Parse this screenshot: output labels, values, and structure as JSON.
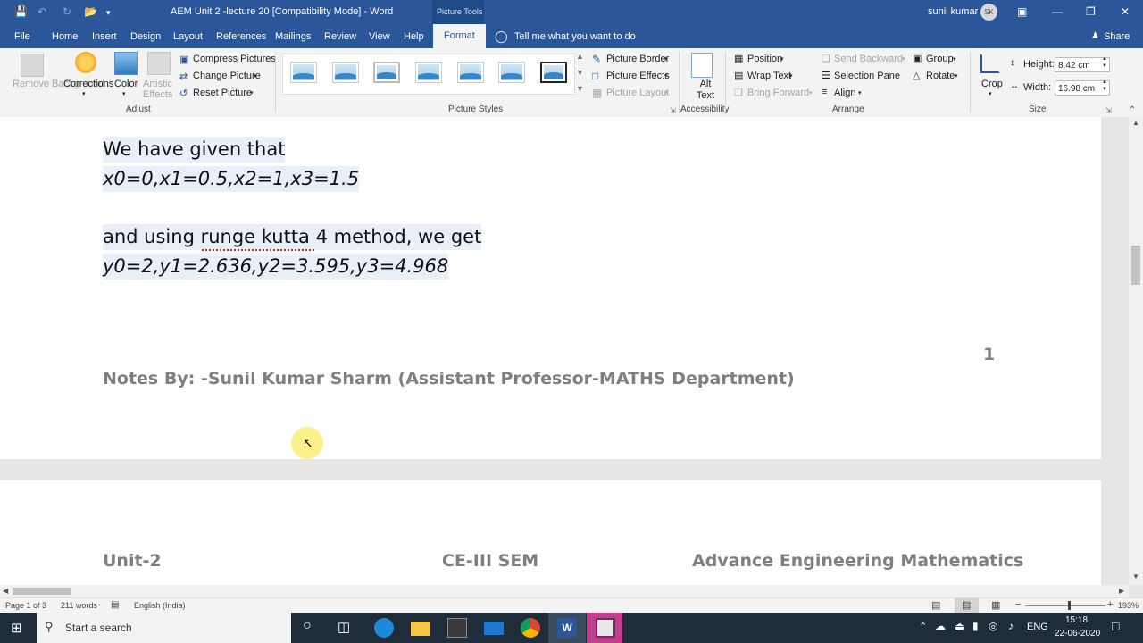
{
  "titlebar": {
    "doc_title": "AEM Unit 2 -lecture 20 [Compatibility Mode] - Word",
    "context_title": "Picture Tools",
    "user_name": "sunil kumar",
    "user_initials": "SK"
  },
  "tabs": [
    "File",
    "Home",
    "Insert",
    "Design",
    "Layout",
    "References",
    "Mailings",
    "Review",
    "View",
    "Help",
    "Format"
  ],
  "tell_me": "Tell me what you want to do",
  "share": "Share",
  "ribbon": {
    "remove_background": "Remove Background",
    "corrections": "Corrections",
    "color": "Color",
    "artistic_effects": "Artistic Effects",
    "compress_pictures": "Compress Pictures",
    "change_picture": "Change Picture",
    "reset_picture": "Reset Picture",
    "group_adjust": "Adjust",
    "group_picture_styles": "Picture Styles",
    "picture_border": "Picture Border",
    "picture_effects": "Picture Effects",
    "picture_layout": "Picture Layout",
    "alt_text": "Alt Text",
    "group_accessibility": "Accessibility",
    "position": "Position",
    "wrap_text": "Wrap Text",
    "bring_forward": "Bring Forward",
    "send_backward": "Send Backward",
    "selection_pane": "Selection Pane",
    "align": "Align",
    "group": "Group",
    "rotate": "Rotate",
    "group_arrange": "Arrange",
    "crop": "Crop",
    "height_label": "Height:",
    "height_value": "8.42 cm",
    "width_label": "Width:",
    "width_value": "16.98 cm",
    "group_size": "Size"
  },
  "document": {
    "line1": "We have given that",
    "line2": "x0=0,x1=0.5,x2=1,x3=1.5",
    "line3": "and using runge kutta 4 method, we get",
    "line4": "y0=2,y1=2.636,y2=3.595,y3=4.968",
    "page_number": "1",
    "footer": "Notes By: -Sunil Kumar Sharm (Assistant Professor-MATHS Department)",
    "header_left": "Unit-2",
    "header_center": "CE-III SEM",
    "header_right": "Advance Engineering Mathematics"
  },
  "status": {
    "page": "Page 1 of 3",
    "words": "211 words",
    "language": "English (India)",
    "zoom": "193%"
  },
  "taskbar": {
    "search_placeholder": "Start a search",
    "language": "ENG",
    "time": "15:18",
    "date": "22-06-2020"
  }
}
